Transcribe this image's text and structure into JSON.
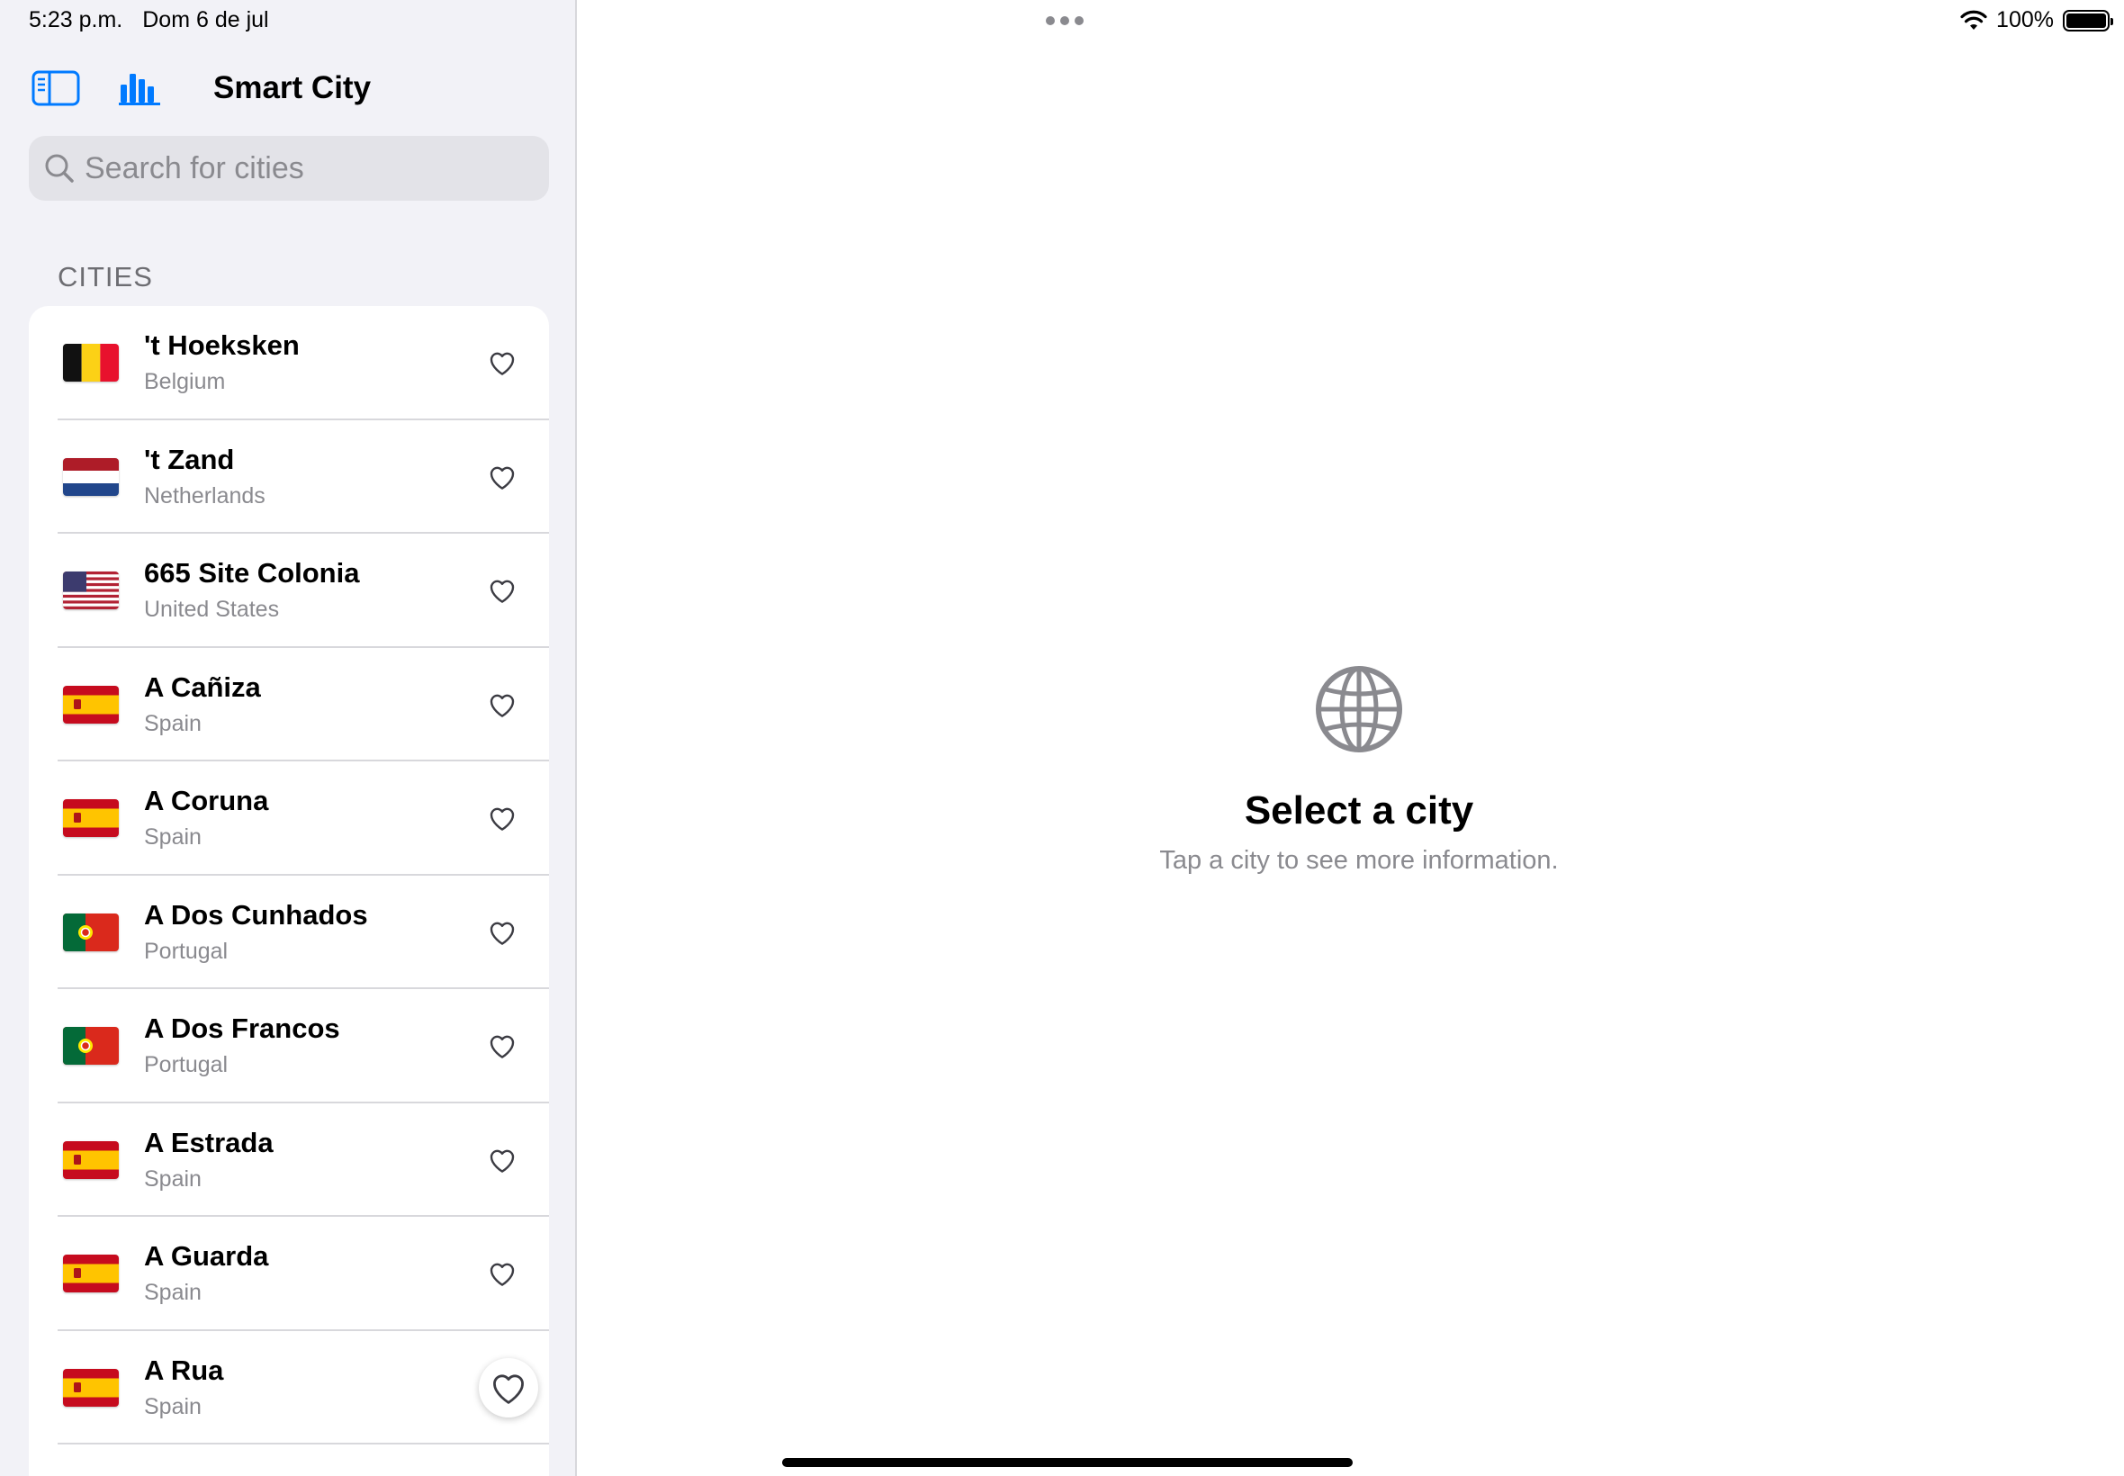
{
  "status_bar": {
    "time": "5:23 p.m.",
    "date": "Dom 6 de jul",
    "battery_percent": "100%",
    "battery_level": 1.0
  },
  "sidebar": {
    "title": "Smart City",
    "search_placeholder": "Search for cities",
    "section_header": "CITIES",
    "cities": [
      {
        "name": "'t Hoeksken",
        "country": "Belgium",
        "flag": "belgium-flag"
      },
      {
        "name": "'t Zand",
        "country": "Netherlands",
        "flag": "netherlands-flag"
      },
      {
        "name": "665 Site Colonia",
        "country": "United States",
        "flag": "us-flag"
      },
      {
        "name": "A Cañiza",
        "country": "Spain",
        "flag": "spain-flag"
      },
      {
        "name": "A Coruna",
        "country": "Spain",
        "flag": "spain-flag"
      },
      {
        "name": "A Dos Cunhados",
        "country": "Portugal",
        "flag": "portugal-flag"
      },
      {
        "name": "A Dos Francos",
        "country": "Portugal",
        "flag": "portugal-flag"
      },
      {
        "name": "A Estrada",
        "country": "Spain",
        "flag": "spain-flag"
      },
      {
        "name": "A Guarda",
        "country": "Spain",
        "flag": "spain-flag"
      },
      {
        "name": "A Rua",
        "country": "Spain",
        "flag": "spain-flag"
      }
    ]
  },
  "detail": {
    "icon": "globe-icon",
    "title": "Select a city",
    "subtitle": "Tap a city to see more information."
  },
  "colors": {
    "accent": "#007aff",
    "sidebar_bg": "#f2f2f7",
    "secondary_text": "#8a8a8f"
  }
}
